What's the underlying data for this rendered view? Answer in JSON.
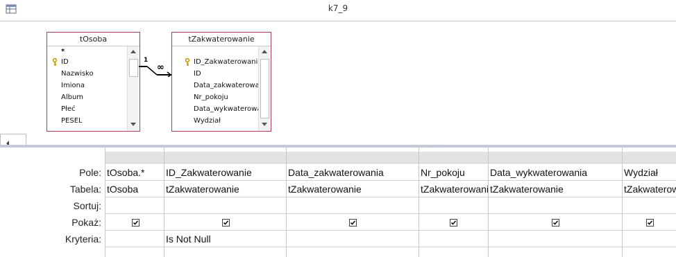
{
  "window": {
    "title": "k7_9"
  },
  "tables": [
    {
      "name": "tOsoba",
      "fields": [
        "*",
        "ID",
        "Nazwisko",
        "Imiona",
        "Album",
        "Płeć",
        "PESEL"
      ],
      "key_field": "ID"
    },
    {
      "name": "tZakwaterowanie",
      "fields": [
        "ID_Zakwaterowanie",
        "ID",
        "Data_zakwaterowania",
        "Nr_pokoju",
        "Data_wykwaterowania",
        "Wydział"
      ],
      "key_field": "ID_Zakwaterowanie"
    }
  ],
  "relationship": {
    "one": "1",
    "many": "∞"
  },
  "grid": {
    "row_labels": {
      "field": "Pole:",
      "table": "Tabela:",
      "sort": "Sortuj:",
      "show": "Pokaż:",
      "criteria": "Kryteria:"
    },
    "columns": [
      {
        "field": "tOsoba.*",
        "table": "tOsoba",
        "sort": "",
        "show": true,
        "criteria": ""
      },
      {
        "field": "ID_Zakwaterowanie",
        "table": "tZakwaterowanie",
        "sort": "",
        "show": true,
        "criteria": "Is Not Null"
      },
      {
        "field": "Data_zakwaterowania",
        "table": "tZakwaterowanie",
        "sort": "",
        "show": true,
        "criteria": ""
      },
      {
        "field": "Nr_pokoju",
        "table": "tZakwaterowanie",
        "sort": "",
        "show": true,
        "criteria": ""
      },
      {
        "field": "Data_wykwaterowania",
        "table": "tZakwaterowanie",
        "sort": "",
        "show": true,
        "criteria": ""
      },
      {
        "field": "Wydział",
        "table": "tZakwaterowanie",
        "sort": "",
        "show": true,
        "criteria": ""
      }
    ]
  },
  "icons": [
    "query-design-icon",
    "key-icon",
    "scroll-up-icon",
    "scroll-down-icon",
    "scroll-left-icon",
    "checkbox-checked-icon"
  ]
}
